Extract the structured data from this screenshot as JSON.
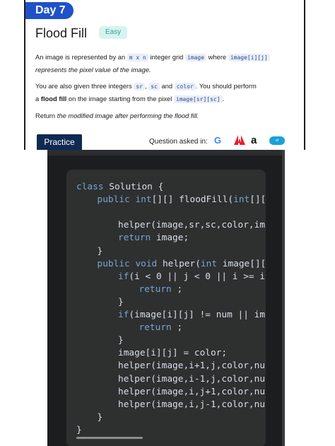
{
  "header": {
    "day_label": "Day 7",
    "title": "Flood Fill",
    "difficulty": "Easy"
  },
  "description": {
    "p1": {
      "t1": "An image is represented by an ",
      "c1": "m x n",
      "t2": " integer grid ",
      "c2": "image",
      "t3": " where ",
      "c3": "image[i][j]",
      "t4": "represents the pixel value of the image."
    },
    "p2": {
      "t1": "You are also given three integers ",
      "c1": "sr",
      "t2": ", ",
      "c2": "sc",
      "t3": " and ",
      "c3": "color",
      "t4": ". You should perform",
      "t5": "a ",
      "b1": "flood fill",
      "t6": " on the image starting from the pixel ",
      "c4": "image[sr][sc]",
      "t7": "."
    },
    "p3": {
      "t1": "Return ",
      "i1": "the modified image after performing the flood fill."
    }
  },
  "actions": {
    "practice_label": "Practice",
    "asked_label": "Question asked in:"
  },
  "companies": [
    {
      "name": "google",
      "glyph": "G",
      "color": "#4285f4"
    },
    {
      "name": "adobe",
      "glyph": "A",
      "color": "#ed1c24"
    },
    {
      "name": "amazon",
      "glyph": "a",
      "color": "#111111"
    },
    {
      "name": "salesforce",
      "glyph": "sf",
      "color": "#1aa0db"
    }
  ],
  "colors": {
    "accent_blue": "#1f52c9",
    "badge_bg": "#d8f3ef",
    "badge_text": "#27a690",
    "code_bg": "#2d302f",
    "keyword": "#7aa2d6"
  },
  "code": {
    "lines": [
      {
        "indent": 0,
        "tokens": [
          {
            "t": "class ",
            "c": "#7aa2d6"
          },
          {
            "t": "Solution {",
            "c": "#d8dee9"
          }
        ]
      },
      {
        "indent": 1,
        "tokens": [
          {
            "t": "public ",
            "c": "#7aa2d6"
          },
          {
            "t": "int",
            "c": "#7aa2d6"
          },
          {
            "t": "[][] floodFill(",
            "c": "#d8dee9"
          },
          {
            "t": "int",
            "c": "#7aa2d6"
          },
          {
            "t": "[][",
            "c": "#d8dee9"
          }
        ]
      },
      {
        "indent": 0,
        "tokens": []
      },
      {
        "indent": 2,
        "tokens": [
          {
            "t": "helper(image,sr,sc,color,im",
            "c": "#d8dee9"
          }
        ]
      },
      {
        "indent": 2,
        "tokens": [
          {
            "t": "return ",
            "c": "#7aa2d6"
          },
          {
            "t": "image;",
            "c": "#d8dee9"
          }
        ]
      },
      {
        "indent": 1,
        "tokens": [
          {
            "t": "}",
            "c": "#d8dee9"
          }
        ]
      },
      {
        "indent": 1,
        "tokens": [
          {
            "t": "public ",
            "c": "#7aa2d6"
          },
          {
            "t": "void ",
            "c": "#7aa2d6"
          },
          {
            "t": "helper(",
            "c": "#d8dee9"
          },
          {
            "t": "int ",
            "c": "#7aa2d6"
          },
          {
            "t": "image[][",
            "c": "#d8dee9"
          }
        ]
      },
      {
        "indent": 2,
        "tokens": [
          {
            "t": "if",
            "c": "#7aa2d6"
          },
          {
            "t": "(i < 0 || j < 0 || i >= i",
            "c": "#d8dee9"
          }
        ]
      },
      {
        "indent": 3,
        "tokens": [
          {
            "t": "return ",
            "c": "#7aa2d6"
          },
          {
            "t": ";",
            "c": "#d8dee9"
          }
        ]
      },
      {
        "indent": 2,
        "tokens": [
          {
            "t": "}",
            "c": "#d8dee9"
          }
        ]
      },
      {
        "indent": 2,
        "tokens": [
          {
            "t": "if",
            "c": "#7aa2d6"
          },
          {
            "t": "(image[i][j] != num || im",
            "c": "#d8dee9"
          }
        ]
      },
      {
        "indent": 3,
        "tokens": [
          {
            "t": "return ",
            "c": "#7aa2d6"
          },
          {
            "t": ";",
            "c": "#d8dee9"
          }
        ]
      },
      {
        "indent": 2,
        "tokens": [
          {
            "t": "}",
            "c": "#d8dee9"
          }
        ]
      },
      {
        "indent": 2,
        "tokens": [
          {
            "t": "image[i][j] = color;",
            "c": "#d8dee9"
          }
        ]
      },
      {
        "indent": 2,
        "tokens": [
          {
            "t": "helper(image,i+1,j,color,nu",
            "c": "#d8dee9"
          }
        ]
      },
      {
        "indent": 2,
        "tokens": [
          {
            "t": "helper(image,i-1,j,color,nu",
            "c": "#d8dee9"
          }
        ]
      },
      {
        "indent": 2,
        "tokens": [
          {
            "t": "helper(image,i,j+1,color,nu",
            "c": "#d8dee9"
          }
        ]
      },
      {
        "indent": 2,
        "tokens": [
          {
            "t": "helper(image,i,j-1,color,nu",
            "c": "#d8dee9"
          }
        ]
      },
      {
        "indent": 1,
        "tokens": [
          {
            "t": "}",
            "c": "#d8dee9"
          }
        ]
      },
      {
        "indent": 0,
        "tokens": [
          {
            "t": "}",
            "c": "#d8dee9"
          }
        ]
      }
    ]
  }
}
